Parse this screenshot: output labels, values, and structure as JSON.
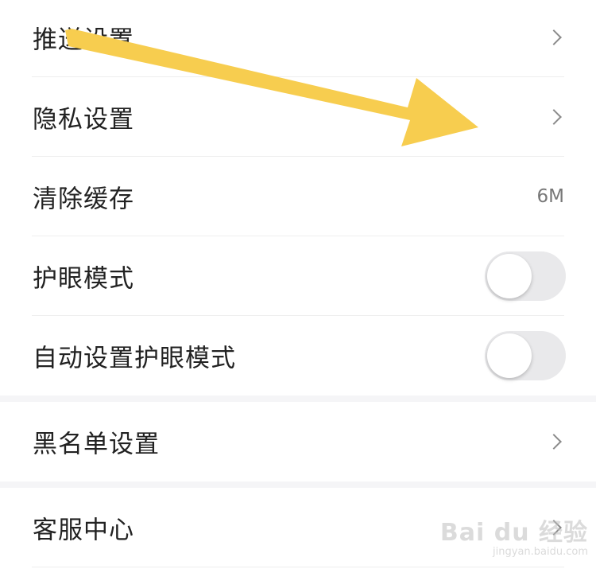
{
  "settings": {
    "group1": [
      {
        "label": "推送设置",
        "control": "chevron-right-icon"
      },
      {
        "label": "隐私设置",
        "control": "chevron-right-icon"
      },
      {
        "label": "清除缓存",
        "value": "6M"
      },
      {
        "label": "护眼模式",
        "control": "toggle",
        "on": false
      },
      {
        "label": "自动设置护眼模式",
        "control": "toggle",
        "on": false
      }
    ],
    "group2": [
      {
        "label": "黑名单设置",
        "control": "chevron-right-icon"
      }
    ],
    "group3": [
      {
        "label": "客服中心",
        "control": "chevron-right-icon"
      }
    ]
  },
  "annotation": {
    "icon": "yellow-arrow-icon",
    "color": "#f7cd4f"
  },
  "watermark": {
    "main": "Bai du 经验",
    "sub": "jingyan.baidu.com"
  },
  "colors": {
    "background": "#f5f5f7",
    "card": "#ffffff",
    "text": "#222222",
    "toggle_off": "#e9e9eb"
  }
}
